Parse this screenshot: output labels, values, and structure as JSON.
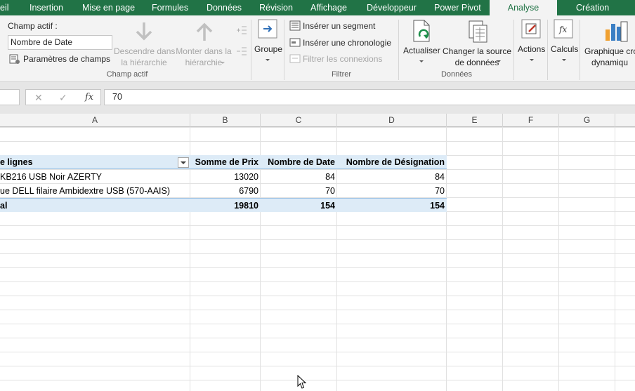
{
  "tabs": [
    {
      "label": "eil"
    },
    {
      "label": "Insertion"
    },
    {
      "label": "Mise en page"
    },
    {
      "label": "Formules"
    },
    {
      "label": "Données"
    },
    {
      "label": "Révision"
    },
    {
      "label": "Affichage"
    },
    {
      "label": "Développeur"
    },
    {
      "label": "Power Pivot"
    },
    {
      "label": "Analyse",
      "active": true
    },
    {
      "label": "Création"
    }
  ],
  "ribbon": {
    "active_field": {
      "label": "Champ actif :",
      "value": "Nombre de Date",
      "field_settings": "Paramètres de champs",
      "drill_down": [
        "Descendre dans",
        "la hiérarchie"
      ],
      "drill_up": [
        "Monter dans la",
        "hiérarchie"
      ],
      "group_label": "Champ actif"
    },
    "group": {
      "label": "Groupe"
    },
    "filter": {
      "insert_slicer": "Insérer un segment",
      "insert_timeline": "Insérer une chronologie",
      "filter_connections": "Filtrer les connexions",
      "group_label": "Filtrer"
    },
    "data": {
      "refresh": "Actualiser",
      "change_source": [
        "Changer la source",
        "de données"
      ],
      "group_label": "Données"
    },
    "actions": {
      "label": "Actions"
    },
    "calculations": {
      "label": "Calculs"
    },
    "pivot_chart": {
      "label": [
        "Graphique cro",
        "dynamiqu"
      ]
    }
  },
  "formula_bar": {
    "cancel_glyph": "✕",
    "enter_glyph": "✓",
    "fx_glyph": "fx",
    "value": "70"
  },
  "columns": [
    "A",
    "B",
    "C",
    "D",
    "E",
    "F",
    "G"
  ],
  "pivot": {
    "headers": [
      "e lignes",
      "Somme de Prix",
      "Nombre de Date",
      "Nombre de Désignation"
    ],
    "rows": [
      [
        "KB216 USB Noir AZERTY",
        "13020",
        "84",
        "84"
      ],
      [
        "ue DELL filaire Ambidextre USB (570-AAIS)",
        "6790",
        "70",
        "70"
      ]
    ],
    "total": [
      "al",
      "19810",
      "154",
      "154"
    ]
  },
  "colors": {
    "accent": "#217346",
    "pivot_header_bg": "#ddebf7",
    "ribbon_bg": "#f3f3f3"
  }
}
